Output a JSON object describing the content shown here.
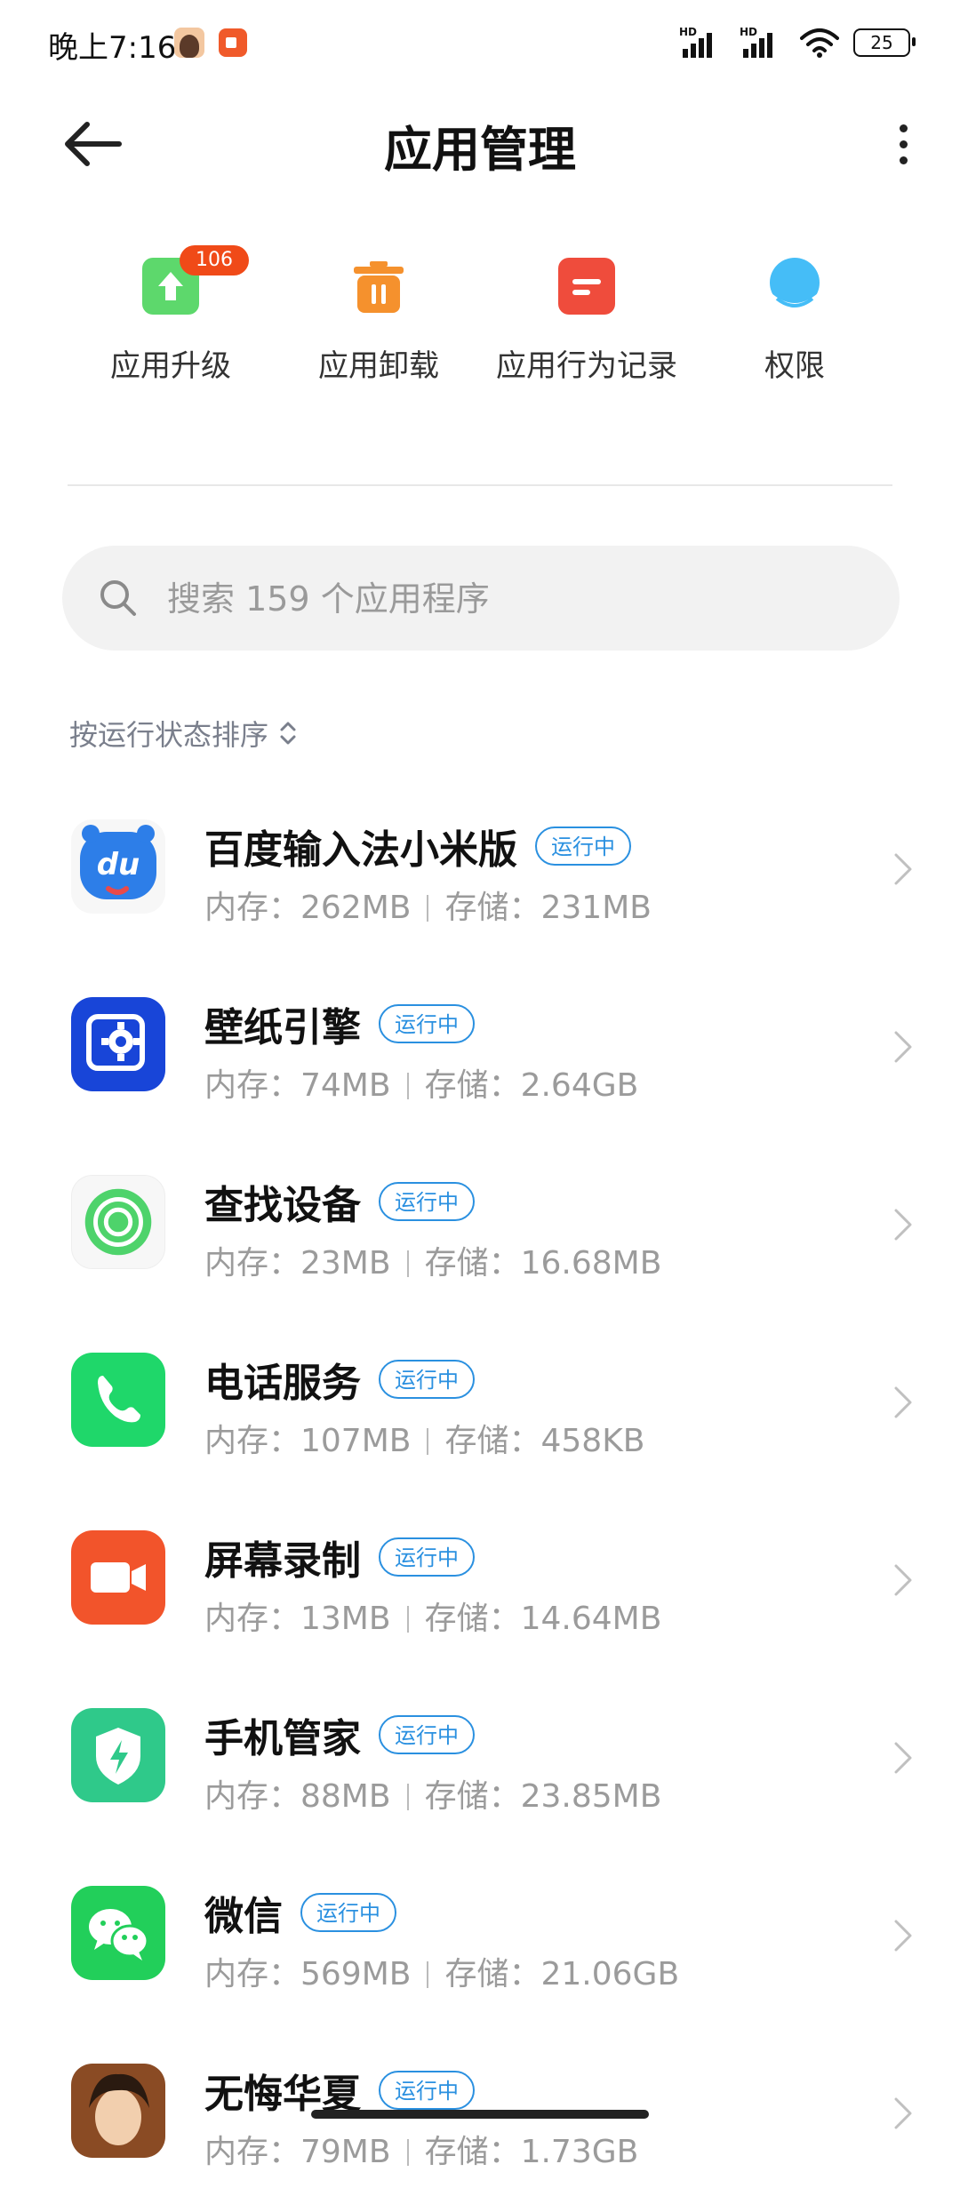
{
  "status_bar": {
    "time": "晚上7:16",
    "battery": "25"
  },
  "header": {
    "title": "应用管理"
  },
  "actions": [
    {
      "label": "应用升级",
      "badge": "106",
      "color": "#4cd964"
    },
    {
      "label": "应用卸载",
      "color": "#f5912d"
    },
    {
      "label": "应用行为记录",
      "color": "#ef4c3c"
    },
    {
      "label": "权限",
      "color": "#3eb7f5"
    }
  ],
  "search": {
    "placeholder": "搜索 159 个应用程序"
  },
  "sort": {
    "label": "按运行状态排序"
  },
  "apps": [
    {
      "name": "百度输入法小米版",
      "status": "运行中",
      "memory": "内存：262MB",
      "storage": "存储：231MB"
    },
    {
      "name": "壁纸引擎",
      "status": "运行中",
      "memory": "内存：74MB",
      "storage": "存储：2.64GB"
    },
    {
      "name": "查找设备",
      "status": "运行中",
      "memory": "内存：23MB",
      "storage": "存储：16.68MB"
    },
    {
      "name": "电话服务",
      "status": "运行中",
      "memory": "内存：107MB",
      "storage": "存储：458KB"
    },
    {
      "name": "屏幕录制",
      "status": "运行中",
      "memory": "内存：13MB",
      "storage": "存储：14.64MB"
    },
    {
      "name": "手机管家",
      "status": "运行中",
      "memory": "内存：88MB",
      "storage": "存储：23.85MB"
    },
    {
      "name": "微信",
      "status": "运行中",
      "memory": "内存：569MB",
      "storage": "存储：21.06GB"
    },
    {
      "name": "无悔华夏",
      "status": "运行中",
      "memory": "内存：79MB",
      "storage": "存储：1.73GB"
    }
  ]
}
